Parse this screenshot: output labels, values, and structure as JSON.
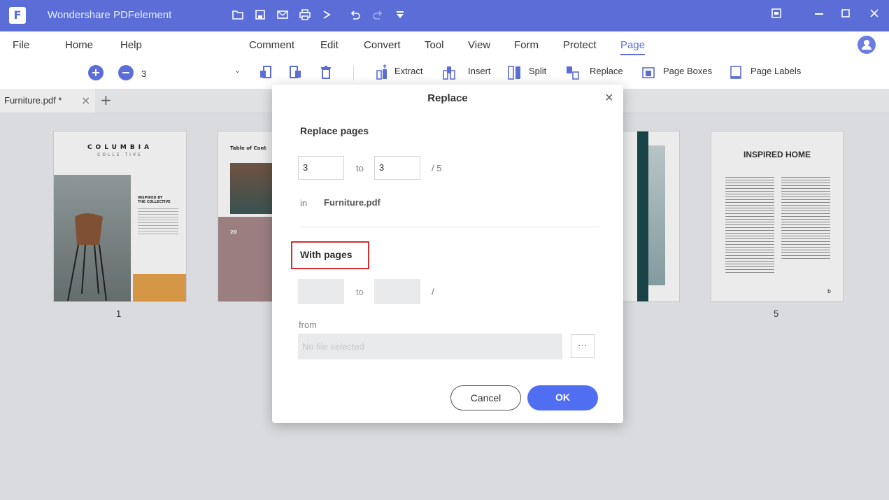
{
  "app": {
    "title": "Wondershare PDFelement",
    "logo_letter": "F",
    "quick_access_icons": [
      "folder-icon",
      "save-icon",
      "mail-icon",
      "print-icon",
      "share-icon",
      "undo-icon",
      "redo-icon",
      "dropdown-icon"
    ],
    "window_controls": [
      "feedback-icon",
      "minimize-icon",
      "maximize-icon",
      "close-icon"
    ],
    "accent_color": "#5b6ed8"
  },
  "menu": {
    "items": [
      "File",
      "Home",
      "Help",
      "Comment",
      "Edit",
      "Convert",
      "Tool",
      "View",
      "Form",
      "Protect",
      "Page"
    ],
    "active": "Page"
  },
  "toolbar": {
    "zoom_value": "3",
    "tools": [
      "Extract",
      "Insert",
      "Split",
      "Replace",
      "Page Boxes",
      "Page Labels"
    ]
  },
  "tabs": {
    "document": "Furniture.pdf *",
    "close_symbol": "×",
    "add_symbol": "+"
  },
  "thumbnails": {
    "page1": {
      "brand": "COLUMBIA",
      "subbrand": "COLLE TIVE",
      "headline": "INSPIRED BY\nTHE COLLECTIVE",
      "number": "1"
    },
    "page2": {
      "heading": "Table of Cont",
      "stat": "20"
    },
    "page5": {
      "heading": "INSPIRED HOME",
      "number": "5",
      "corner": "b"
    }
  },
  "dialog": {
    "title": "Replace",
    "close_symbol": "×",
    "replace_pages": {
      "heading": "Replace pages",
      "from_value": "3",
      "to_label": "to",
      "to_value": "3",
      "total": "/ 5",
      "in_label": "in",
      "file_name": "Furniture.pdf"
    },
    "with_pages": {
      "heading": "With pages",
      "from_value": "",
      "to_label": "to",
      "to_value": "",
      "total": "/",
      "from_label": "from",
      "file_placeholder": "No file selected",
      "browse_label": "···"
    },
    "cancel_label": "Cancel",
    "ok_label": "OK",
    "highlight_color": "#d32f2f"
  }
}
